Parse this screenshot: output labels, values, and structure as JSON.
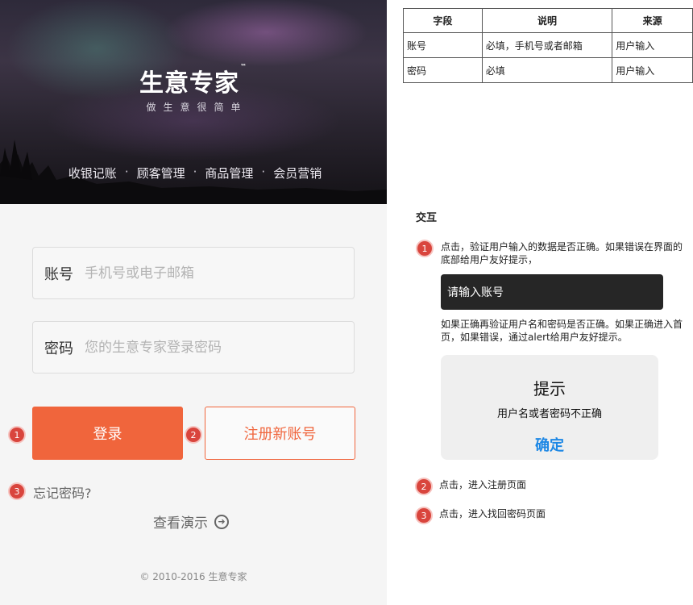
{
  "app": {
    "logo": "生意专家",
    "logo_tm": "™",
    "slogan": "做生意很简单",
    "features": [
      "收银记账",
      "顾客管理",
      "商品管理",
      "会员营销"
    ],
    "feature_separator": "·"
  },
  "login_form": {
    "account_label": "账号",
    "account_placeholder": "手机号或电子邮箱",
    "password_label": "密码",
    "password_placeholder": "您的生意专家登录密码",
    "login_button": "登录",
    "register_button": "注册新账号",
    "forgot_link": "忘记密码?",
    "demo_link": "查看演示",
    "copyright": "© 2010-2016 生意专家"
  },
  "markers": {
    "one": "1",
    "two": "2",
    "three": "3"
  },
  "spec_table": {
    "headers": [
      "字段",
      "说明",
      "来源"
    ],
    "rows": [
      [
        "账号",
        "必填，手机号或者邮箱",
        "用户输入"
      ],
      [
        "密码",
        "必填",
        "用户输入"
      ]
    ]
  },
  "interaction": {
    "title": "交互",
    "note1": "点击，验证用户输入的数据是否正确。如果错误在界面的底部给用户友好提示，",
    "toast_text": "请输入账号",
    "note1b": "如果正确再验证用户名和密码是否正确。如果正确进入首页，如果错误，通过alert给用户友好提示。",
    "dialog_title": "提示",
    "dialog_message": "用户名或者密码不正确",
    "dialog_ok": "确定",
    "note2": "点击，进入注册页面",
    "note3": "点击，进入找回密码页面"
  },
  "colors": {
    "accent": "#f0653c",
    "marker": "#d9453d",
    "link_blue": "#1e88e5"
  },
  "icons": {
    "demo_arrow": "arrow-right-circle-icon"
  }
}
